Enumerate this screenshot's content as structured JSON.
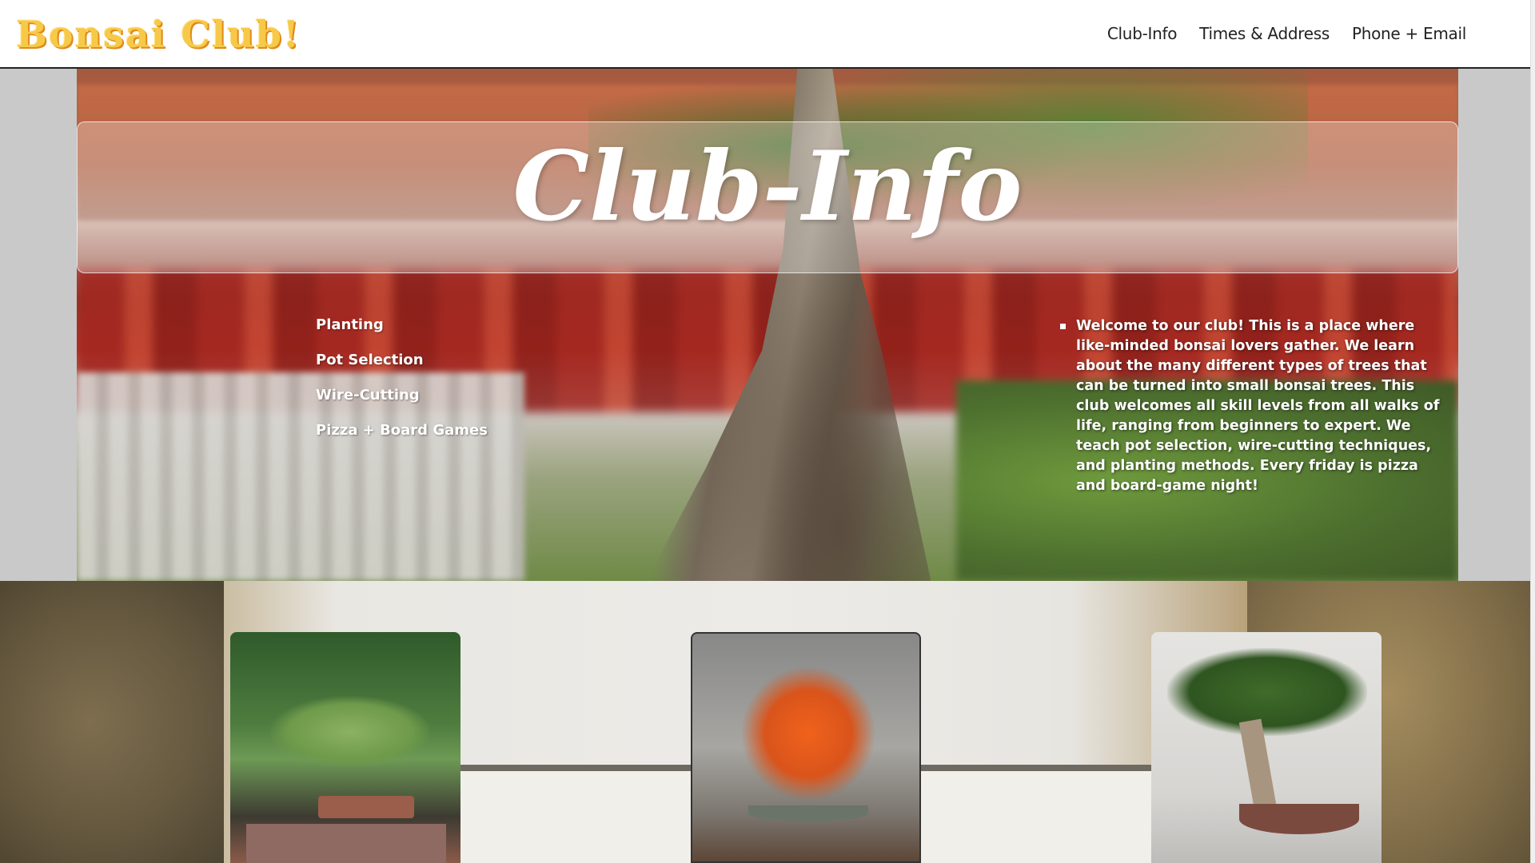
{
  "header": {
    "logo": "Bonsai Club!",
    "nav": [
      {
        "label": "Club-Info"
      },
      {
        "label": "Times & Address"
      },
      {
        "label": "Phone + Email"
      }
    ]
  },
  "hero": {
    "title": "Club-Info",
    "topics": [
      "Planting",
      "Pot Selection",
      "Wire-Cutting",
      "Pizza + Board Games"
    ],
    "welcome": "Welcome to our club! This is a place where like-minded bonsai lovers gather. We learn about the many different types of trees that can be turned into small bonsai trees. This club welcomes all skill levels from all walks of life, ranging from beginners to expert. We teach pot selection, wire-cutting techniques, and planting methods. Every friday is pizza and board-game night!"
  },
  "colors": {
    "logo": "#f7c948",
    "nav_text": "#222222",
    "hero_text": "#ffffff"
  }
}
